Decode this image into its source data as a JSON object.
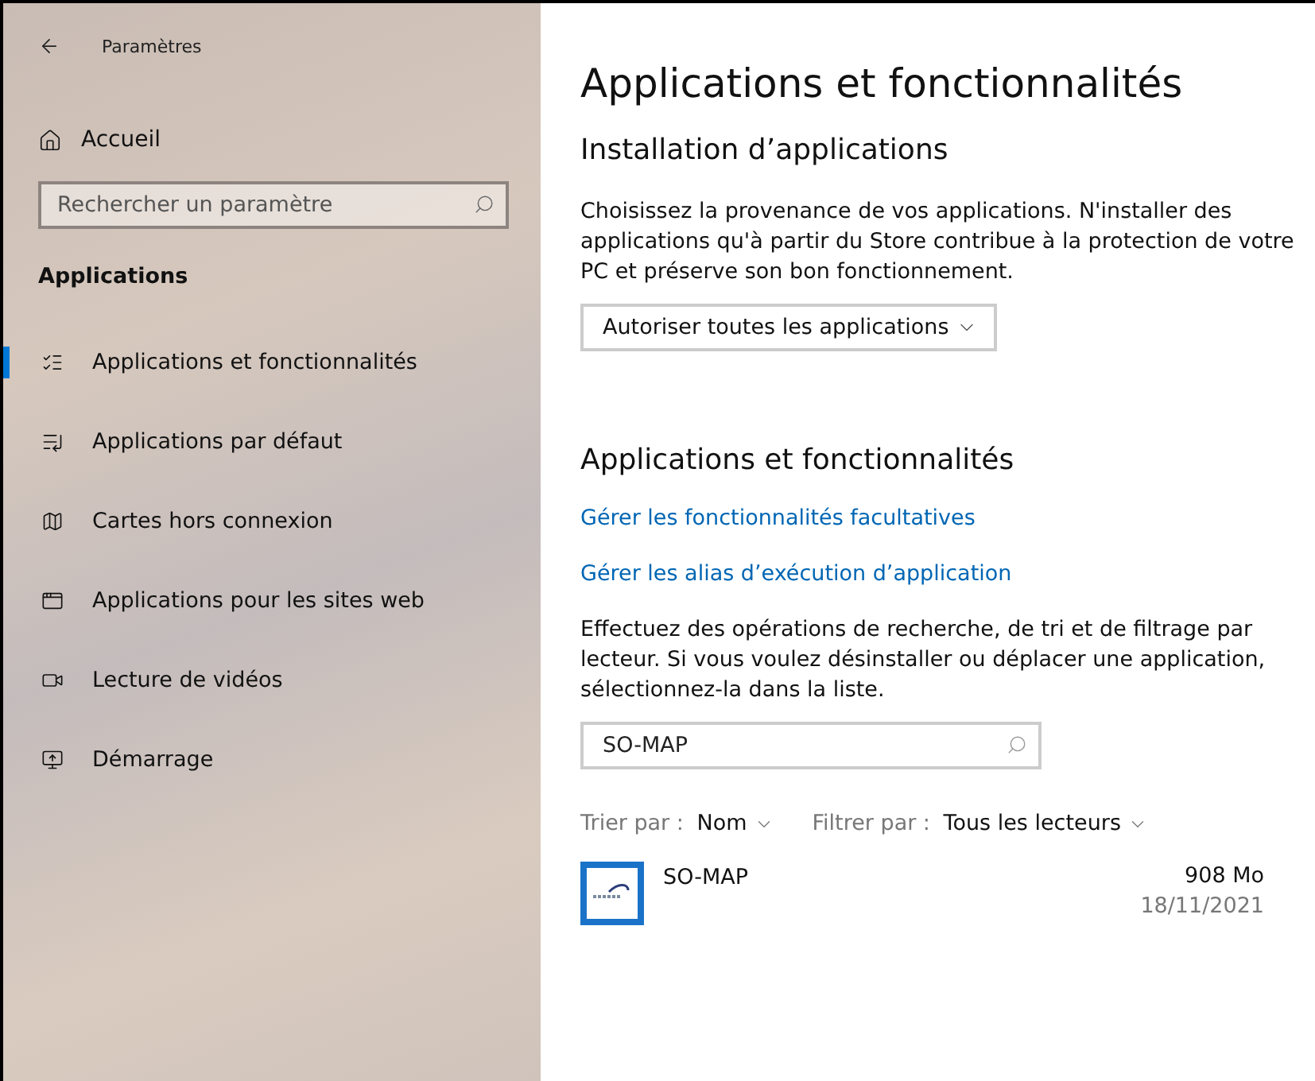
{
  "window": {
    "title": "Paramètres"
  },
  "sidebar": {
    "home": "Accueil",
    "search": {
      "placeholder": "Rechercher un paramètre"
    },
    "section": "Applications",
    "items": [
      {
        "label": "Applications et fonctionnalités",
        "selected": true
      },
      {
        "label": "Applications par défaut",
        "selected": false
      },
      {
        "label": "Cartes hors connexion",
        "selected": false
      },
      {
        "label": "Applications pour les sites web",
        "selected": false
      },
      {
        "label": "Lecture de vidéos",
        "selected": false
      },
      {
        "label": "Démarrage",
        "selected": false
      }
    ]
  },
  "main": {
    "title": "Applications et fonctionnalités",
    "install": {
      "heading": "Installation d’applications",
      "text": "Choisissez la provenance de vos applications. N'installer des applications qu'à partir du Store contribue à la protection de votre PC et préserve son bon fonctionnement.",
      "dropdown": "Autoriser toutes les applications"
    },
    "apps": {
      "heading": "Applications et fonctionnalités",
      "links": [
        "Gérer les fonctionnalités facultatives",
        "Gérer les alias d’exécution d’application"
      ],
      "text": "Effectuez des opérations de recherche, de tri et de filtrage par lecteur. Si vous voulez désinstaller ou déplacer une application, sélectionnez-la dans la liste.",
      "search": {
        "value": "SO-MAP"
      },
      "sort": {
        "label": "Trier par :",
        "value": "Nom"
      },
      "filter": {
        "label": "Filtrer par :",
        "value": "Tous les lecteurs"
      },
      "list": [
        {
          "name": "SO-MAP",
          "size": "908 Mo",
          "date": "18/11/2021"
        }
      ]
    }
  }
}
